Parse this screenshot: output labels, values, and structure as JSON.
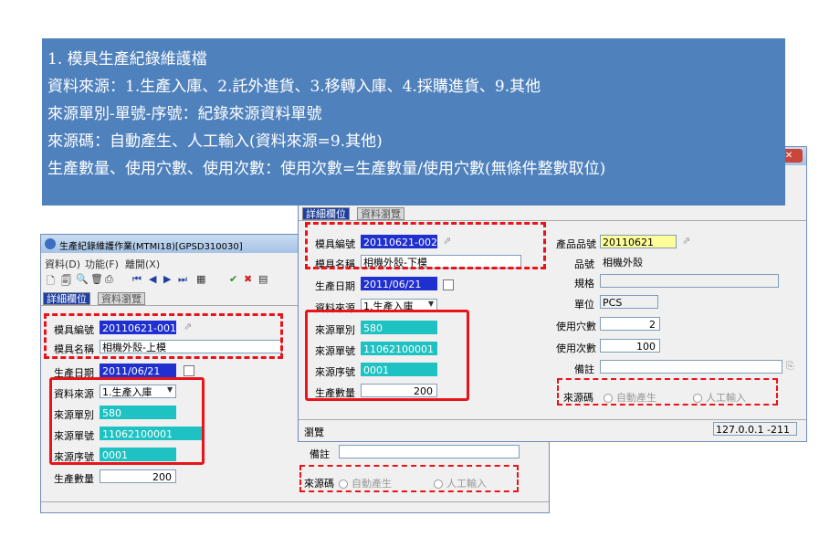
{
  "note": {
    "lines": [
      "1. 模具生產紀錄維護檔",
      "資料來源：1.生產入庫、2.託外進貨、3.移轉入庫、4.採購進貨、9.其他",
      "來源單別-單號-序號：紀錄來源資料單號",
      "來源碼：自動產生、人工輸入(資料來源=9.其他)",
      "生產數量、使用穴數、使用次數：使用次數=生產數量/使用穴數(無條件整數取位)"
    ]
  },
  "back_window": {
    "title": "生產紀錄維護作業(MTMI18)[GPSD310030]",
    "menu": [
      "資料(D)",
      "功能(F)",
      "離開(X)"
    ],
    "tabs": [
      "詳細欄位",
      "資料瀏覽"
    ],
    "fields": {
      "mold_no_label": "模具編號",
      "mold_no": "20110621-001",
      "mold_name_label": "模具名稱",
      "mold_name": "相機外殼-上模",
      "prod_date_label": "生產日期",
      "prod_date": "2011/06/21",
      "source_label": "資料來源",
      "source": "1.生產入庫",
      "src_type_label": "來源單別",
      "src_type": "580",
      "src_no_label": "來源單號",
      "src_no": "11062100001",
      "src_seq_label": "來源序號",
      "src_seq": "0001",
      "qty_label": "生產數量",
      "qty": "200"
    }
  },
  "bottom_fragment": {
    "remark_label": "備註",
    "source_code_label": "來源碼",
    "radio_auto": "自動產生",
    "radio_manual": "人工輸入"
  },
  "front_window": {
    "tabs": [
      "詳細欄位",
      "資料瀏覽"
    ],
    "fields": {
      "mold_no_label": "模具編號",
      "mold_no": "20110621-002",
      "mold_name_label": "模具名稱",
      "mold_name": "相機外殼-下模",
      "prod_date_label": "生產日期",
      "prod_date": "2011/06/21",
      "source_label": "資料來源",
      "source": "1.生產入庫",
      "src_type_label": "來源單別",
      "src_type": "580",
      "src_no_label": "來源單號",
      "src_no": "11062100001",
      "src_seq_label": "來源序號",
      "src_seq": "0001",
      "qty_label": "生產數量",
      "qty": "200",
      "product_no_label": "產品品號",
      "product_no": "20110621",
      "product_name_label": "品號",
      "product_name": "相機外殼",
      "spec_label": "規格",
      "spec": "",
      "unit_label": "單位",
      "unit": "PCS",
      "cavities_label": "使用穴數",
      "cavities": "2",
      "uses_label": "使用次數",
      "uses": "100",
      "remark_label": "備註",
      "remark": "",
      "source_code_label": "來源碼",
      "radio_auto": "自動產生",
      "radio_manual": "人工輸入"
    },
    "status": {
      "left": "瀏覽",
      "right": "127.0.0.1 -211"
    }
  },
  "colors": {
    "note_bg": "#4f81bd",
    "highlight_red": "#e8141a",
    "cyan_field": "#1fc2c2",
    "blue_field": "#1f2fd0"
  }
}
